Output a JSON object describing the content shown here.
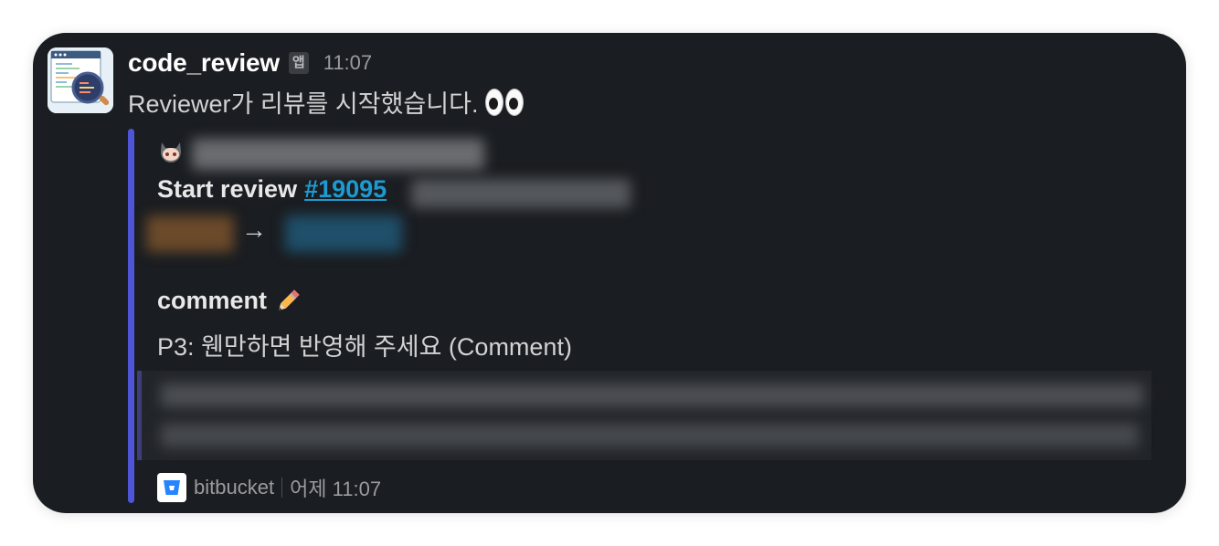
{
  "bot": {
    "name": "code_review",
    "badge": "앱",
    "time": "11:07",
    "avatar_icon": "code-review-magnifier-icon"
  },
  "message": {
    "text": "Reviewer가 리뷰를 시작했습니다.",
    "emoji": "eyes-icon"
  },
  "attachment": {
    "author_icon": "octocat-icon",
    "start_review_label": "Start review",
    "pr_link": "#19095",
    "arrow": "→",
    "comment_title": "comment",
    "comment_emoji": "pencil-icon",
    "comment_text": "P3: 웬만하면 반영해 주세요 (Comment)",
    "footer_source": "bitbucket",
    "footer_time": "어제 11:07",
    "footer_icon": "bitbucket-icon",
    "accent_color": "#4e55d6",
    "link_color": "#1d9bd1"
  }
}
